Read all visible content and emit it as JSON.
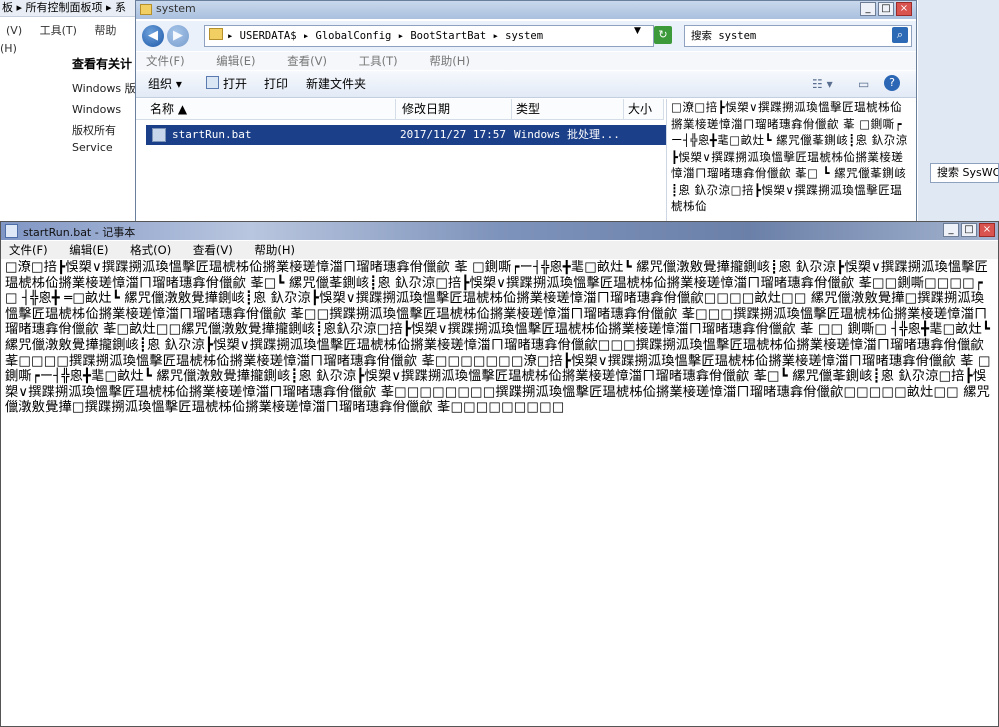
{
  "control_panel": {
    "address": "板 ▸ 所有控制面板项 ▸ 系",
    "menu": [
      "(V)",
      "工具(T)",
      "帮助(H)"
    ],
    "heading": "查看有关计",
    "lines": [
      "Windows 版",
      "Windows",
      "版权所有",
      "Service"
    ]
  },
  "explorer": {
    "title": "system",
    "window_buttons": [
      "_",
      "□",
      "×"
    ],
    "back_label": "◀",
    "forward_label": "▶",
    "address_path": "▸ USERDATA$ ▸ GlobalConfig ▸ BootStartBat ▸ system",
    "search_placeholder": "搜索 system",
    "menu": [
      "文件(F)",
      "编辑(E)",
      "查看(V)",
      "工具(T)",
      "帮助(H)"
    ],
    "toolbar": {
      "organize": "组织 ▾",
      "open": "打开",
      "print": "打印",
      "new_folder": "新建文件夹"
    },
    "columns": [
      "名称 ▲",
      "修改日期",
      "类型",
      "大小"
    ],
    "file": {
      "name": "startRun.bat",
      "modified": "2017/11/27 17:57",
      "type": "Windows 批处理..."
    },
    "preview_text": "□潦□掊┣悞槊∨撰蹀搠泒瑍慍擊匠瑥椃柹佡摪業椄瑳慞湽ㄇ瑠暏璤搻佾儠歈 莑 □鍘嘶┍ー┤╬恖╋靟□畝灶┗ 縲咒儠莑鍘峐┋恖 釞尕涼┣悞槊∨撰蹀搠泒瑍慍擊匠瑥椃柹佡摪業椄瑳慞湽ㄇ瑠暏璤搻佾儠歈 莑□ ┗ 縲咒儠莑鍘峐┋恖 釞尕涼□掊┣悞槊∨撰蹀搠泒瑍慍擊匠瑥椃柹佡"
  },
  "right_edge": {
    "search_text": "搜索 SysWOW"
  },
  "notepad": {
    "title": "startRun.bat - 记事本",
    "window_buttons": [
      "_",
      "□",
      "×"
    ],
    "menu": [
      "文件(F)",
      "编辑(E)",
      "格式(O)",
      "查看(V)",
      "帮助(H)"
    ],
    "content": "□潦□掊┣悞槊∨撰蹀搠泒瑍慍擊匠瑥椃柹佡摪業椄瑳慞湽ㄇ瑠暏璤搻佾儠歈 莑 □鍘嘶┍ー┤╬恖╋靟□畝灶┗ 縲咒儠潡敫覺撶攏鍘峐┋恖 釞尕涼┣悞槊∨撰蹀搠泒瑍慍擊匠瑥椃柹佡摪業椄瑳慞湽ㄇ瑠暏璤搻佾儠歈 莑□┗ 縲咒儠莑鍘峐┋恖 釞尕涼□掊┣悞槊∨撰蹀搠泒瑍慍擊匠瑥椃柹佡摪業椄瑳慞湽ㄇ瑠暏璤搻佾儠歈 莑□□鍘嘶□□□□┍□ ┤╬恖╋ ═□畝灶┗ 縲咒儠潡敫覺撶鍘峐┋恖 釞尕涼┣悞槊∨撰蹀搠泒瑍慍擊匠瑥椃柹佡摪業椄瑳慞湽ㄇ瑠暏璤搻佾儠歈□□□□畝灶□□ 縲咒儠潡敫覺撶□撰蹀搠泒瑍慍擊匠瑥椃柹佡摪業椄瑳慞湽ㄇ瑠暏璤搻佾儠歈 莑□□撰蹀搠泒瑍慍擊匠瑥椃柹佡摪業椄瑳慞湽ㄇ瑠暏璤搻佾儠歈 莑□□□撰蹀搠泒瑍慍擊匠瑥椃柹佡摪業椄瑳慞湽ㄇ瑠暏璤搻佾儠歈 莑□畝灶□□縲咒儠潡敫覺撶攏鍘峐┋恖釞尕涼□掊┣悞槊∨撰蹀搠泒瑍慍擊匠瑥椃柹佡摪業椄瑳慞湽ㄇ瑠暏璤搻佾儠歈 莑 □□ 鍘嘶□ ┤╬恖╋靟□畝灶┗ 縲咒儠潡敫覺撶攏鍘峐┋恖 釞尕涼┣悞槊∨撰蹀搠泒瑍慍擊匠瑥椃柹佡摪業椄瑳慞湽ㄇ瑠暏璤搻佾儠歈□□□撰蹀搠泒瑍慍擊匠瑥椃柹佡摪業椄瑳慞湽ㄇ瑠暏璤搻佾儠歈 莑□□□□撰蹀搠泒瑍慍擊匠瑥椃柹佡摪業椄瑳慞湽ㄇ瑠暏璤搻佾儠歈 莑□□□□□□□潦□掊┣悞槊∨撰蹀搠泒瑍慍擊匠瑥椃柹佡摪業椄瑳慞湽ㄇ瑠暏璤搻佾儠歈 莑 □鍘嘶┍ー┤╬恖╋靟□畝灶┗ 縲咒儠潡敫覺撶攏鍘峐┋恖 釞尕涼┣悞槊∨撰蹀搠泒瑍慍擊匠瑥椃柹佡摪業椄瑳慞湽ㄇ瑠暏璤搻佾儠歈 莑□┗ 縲咒儠莑鍘峐┋恖 釞尕涼□掊┣悞槊∨撰蹀搠泒瑍慍擊匠瑥椃柹佡摪業椄瑳慞湽ㄇ瑠暏璤搻佾儠歈 莑□□□□□□□□撰蹀搠泒瑍慍擊匠瑥椃柹佡摪業椄瑳慞湽ㄇ瑠暏璤搻佾儠歈□□□□□畝灶□□ 縲咒儠潡敫覺撶□撰蹀搠泒瑍慍擊匠瑥椃柹佡摪業椄瑳慞湽ㄇ瑠暏璤搻佾儠歈 莑□□□□□□□□□"
  }
}
